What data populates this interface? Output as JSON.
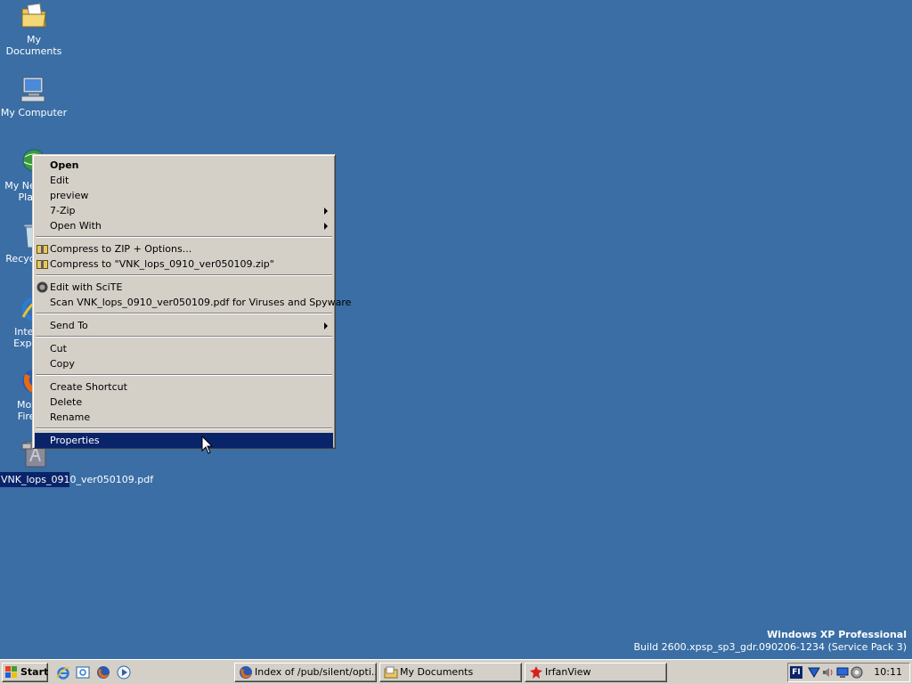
{
  "desktop": {
    "icons": [
      {
        "label": "My Documents"
      },
      {
        "label": "My Computer"
      },
      {
        "label": "My Network Places"
      },
      {
        "label": "Recycle Bin"
      },
      {
        "label": "Internet Explorer"
      },
      {
        "label": "Mozilla Firefox"
      },
      {
        "label": "VNK_lops_0910_ver050109.pdf"
      }
    ]
  },
  "context_menu": {
    "items": {
      "open": "Open",
      "edit": "Edit",
      "preview": "preview",
      "zip7": "7-Zip",
      "open_with": "Open With",
      "compress_options": "Compress to ZIP + Options...",
      "compress_to": "Compress to \"VNK_lops_0910_ver050109.zip\"",
      "edit_scite": "Edit with SciTE",
      "scan": "Scan VNK_lops_0910_ver050109.pdf for Viruses and Spyware",
      "send_to": "Send To",
      "cut": "Cut",
      "copy": "Copy",
      "create_shortcut": "Create Shortcut",
      "delete": "Delete",
      "rename": "Rename",
      "properties": "Properties"
    }
  },
  "watermark": {
    "line1": "Windows XP Professional",
    "line2": "Build 2600.xpsp_sp3_gdr.090206-1234 (Service Pack 3)"
  },
  "taskbar": {
    "start_label": "Start",
    "tasks": [
      {
        "label": "Index of /pub/silent/opti..."
      },
      {
        "label": "My Documents"
      },
      {
        "label": "IrfanView"
      }
    ],
    "tray": {
      "language": "FI",
      "clock": "10:11"
    }
  },
  "colors": {
    "desktop": "#3a6ea5",
    "highlight": "#0a246a",
    "face": "#d4d0c8"
  }
}
